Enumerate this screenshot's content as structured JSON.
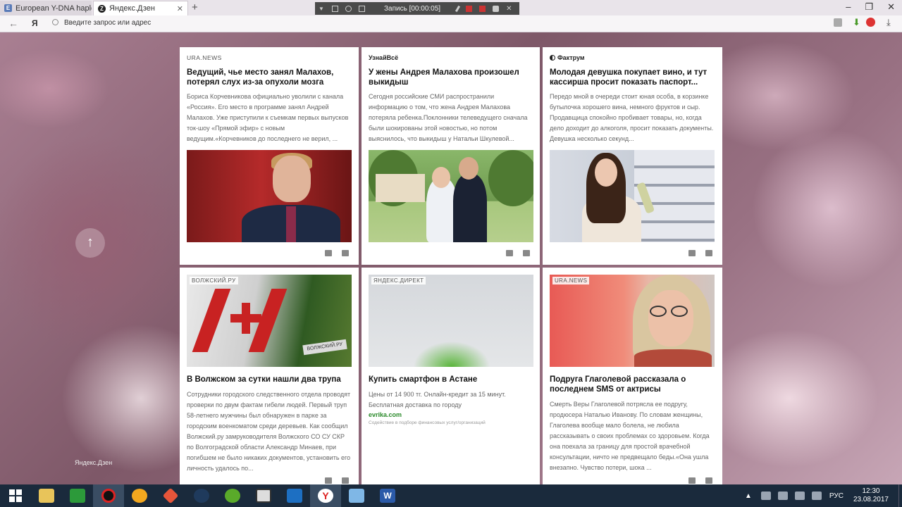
{
  "browser": {
    "tabs": [
      {
        "title": "European Y-DNA haplogrou",
        "icon": "page-icon"
      },
      {
        "title": "Яндекс.Дзен",
        "icon": "zen-icon"
      }
    ],
    "new_tab": "+",
    "recorder_label": "Запись [00:00:05]",
    "logo": "Я",
    "address_placeholder": "Введите запрос или адрес"
  },
  "page": {
    "scroll_top_icon": "arrow-up-icon",
    "footer_label": "Яндекс.Дзен"
  },
  "cards": [
    {
      "source": "URA.NEWS",
      "title": "Ведущий, чье место занял Малахов, потерял слух из-за опухоли мозга",
      "text": "Бориса Корчевникова официально уволили с канала «Россия». Его место в программе занял Андрей Малахов. Уже приступили к съемкам первых выпусков ток-шоу «Прямой эфир» с новым ведущим.«Корчевников до последнего не верил, ..."
    },
    {
      "source": "УзнайВсё",
      "title": "У жены Андрея Малахова произошел выкидыш",
      "text": "Сегодня российские СМИ распространили информацию о том, что жена Андрея Малахова потеряла ребенка.Поклонники телеведущего сначала были шокированы этой новостью, но потом выяснилось, что выкидыш у Натальи Шкулевой..."
    },
    {
      "source": "Фактрум",
      "title": "Молодая девушка покупает вино, и тут кассирша просит показать паспорт...",
      "text": "Передо мной в очереди стоит юная особа, в корзинке бутылочка хорошего вина, немного фруктов и сыр. Продавщица спокойно пробивает товары, но, когда дело доходит до алкоголя, просит показать документы. Девушка несколько секунд..."
    },
    {
      "image_label": "ВОЛЖСКИЙ.РУ",
      "plate_text": "ВОЛЖСКИЙ.РУ",
      "title": "В Волжском за сутки нашли два трупа",
      "text": "Сотрудники городского следственного отдела проводят проверки по двум фактам гибели людей. Первый труп 58-летнего мужчины был обнаружен в парке за городским военкоматом среди деревьев. Как сообщил Волжский.ру замруководителя Волжского СО СУ СКР по Волгоградской области Александр Минаев, при погибшем не было никаких документов, установить его личность удалось по..."
    },
    {
      "image_label": "ЯНДЕКС.ДИРЕКТ",
      "title": "Купить смартфон в Астане",
      "text": "Цены от 14 900 тг. Онлайн-кредит за 15 минут. Бесплатная доставка по городу",
      "link": "evrika.com",
      "note": "Содействие в подборе финансовых услуг/организаций"
    },
    {
      "image_label": "URA.NEWS",
      "title": "Подруга Глаголевой рассказала о последнем SMS от актрисы",
      "text": "Смерть Веры Глаголевой потрясла ее подругу, продюсера Наталью Иванову. По словам женщины, Глаголева вообще мало болела, не любила рассказывать о своих проблемах со здоровьем. Когда она поехала за границу для простой врачебной консультации, ничто не предвещало беды.«Она ушла внезапно. Чувство потери, шока ..."
    }
  ],
  "taskbar": {
    "apps": [
      "start",
      "file-explorer",
      "store",
      "recorder",
      "audio",
      "flame",
      "steam",
      "utorrent",
      "media",
      "video",
      "yandex-browser",
      "photos",
      "word"
    ],
    "language": "РУС",
    "time": "12:30",
    "date": "23.08.2017"
  }
}
